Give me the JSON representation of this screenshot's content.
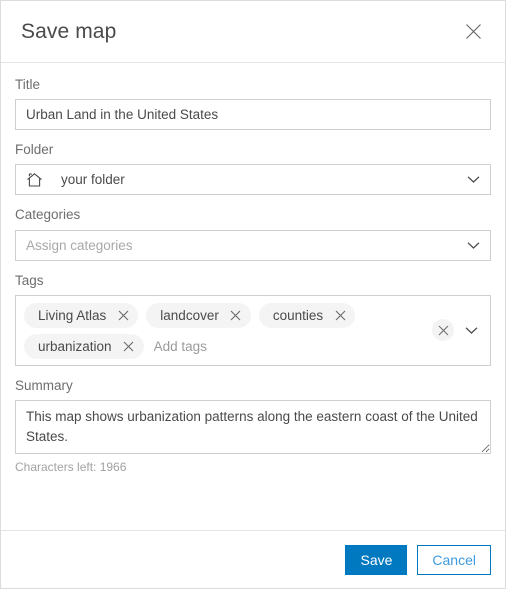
{
  "dialog": {
    "title": "Save map",
    "close_icon": "close-icon"
  },
  "form": {
    "title_field": {
      "label": "Title",
      "value": "Urban Land in the United States",
      "placeholder": "Title"
    },
    "folder_field": {
      "label": "Folder",
      "value": "your folder",
      "leading_icon": "home-icon",
      "chevron_icon": "chevron-down-icon"
    },
    "categories_field": {
      "label": "Categories",
      "value": "",
      "placeholder": "Assign categories",
      "chevron_icon": "chevron-down-icon"
    },
    "tags_field": {
      "label": "Tags",
      "tags": [
        "Living Atlas",
        "landcover",
        "counties",
        "urbanization"
      ],
      "add_placeholder": "Add tags",
      "clear_icon": "close-circle-icon",
      "chevron_icon": "chevron-down-icon"
    },
    "summary_field": {
      "label": "Summary",
      "value": "This map shows urbanization patterns along the eastern coast of the United States.",
      "placeholder": "Summary",
      "characters_left": "Characters left: 1966"
    }
  },
  "footer": {
    "save_label": "Save",
    "cancel_label": "Cancel"
  },
  "colors": {
    "accent": "#0079c1",
    "cancel_text": "#3d9be0",
    "border": "#cfcfcf",
    "label_text": "#6e6e6e",
    "value_text": "#4a4a4a",
    "chip_bg": "#f4f4f4",
    "placeholder_text": "#a8a8a8"
  }
}
